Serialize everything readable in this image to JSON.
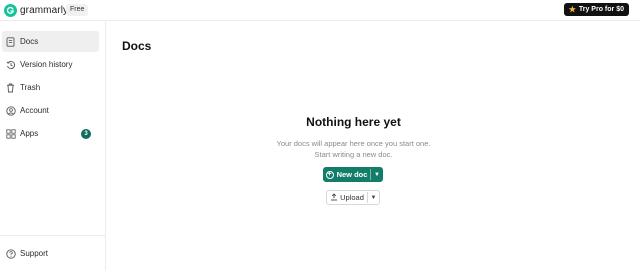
{
  "header": {
    "brand": "grammarly",
    "plan_badge": "Free",
    "pro_button": "Try Pro for $0",
    "pro_icon": "star-icon"
  },
  "sidebar": {
    "items": [
      {
        "label": "Docs",
        "icon": "document-icon",
        "active": true
      },
      {
        "label": "Version history",
        "icon": "history-icon",
        "active": false
      },
      {
        "label": "Trash",
        "icon": "trash-icon",
        "active": false
      },
      {
        "label": "Account",
        "icon": "account-icon",
        "active": false
      },
      {
        "label": "Apps",
        "icon": "apps-icon",
        "active": false,
        "badge": "3"
      }
    ],
    "footer": {
      "label": "Support",
      "icon": "support-icon"
    }
  },
  "main": {
    "title": "Docs",
    "empty_state": {
      "title": "Nothing here yet",
      "line1": "Your docs will appear here once you start one.",
      "line2": "Start writing a new doc."
    },
    "new_doc_button": "New doc",
    "upload_button": "Upload"
  },
  "colors": {
    "brand_green": "#15c39a",
    "primary_button": "#127e6a",
    "badge": "#0f6b5a",
    "pro_button_bg": "#111111"
  }
}
